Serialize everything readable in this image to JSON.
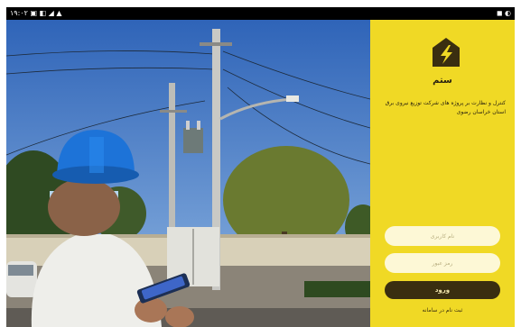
{
  "status_bar": {
    "time": "۱۹:۰۲",
    "left_indicators": "▣ ◧ ◢ ▲",
    "right_indicators": "◼ ◐"
  },
  "app": {
    "brand_name": "ستم",
    "tagline": "کنترل و نظارت بر پروژه های شرکت توزیع نیروی برق استان خراسان رضوی",
    "logo_icon": "house-lightning-icon",
    "accent_color": "#f0d925",
    "button_color": "#3a2e10"
  },
  "login_form": {
    "username_placeholder": "نام کاربری",
    "password_placeholder": "رمز عبور",
    "login_label": "ورود",
    "register_label": "ثبت نام در سامانه"
  }
}
